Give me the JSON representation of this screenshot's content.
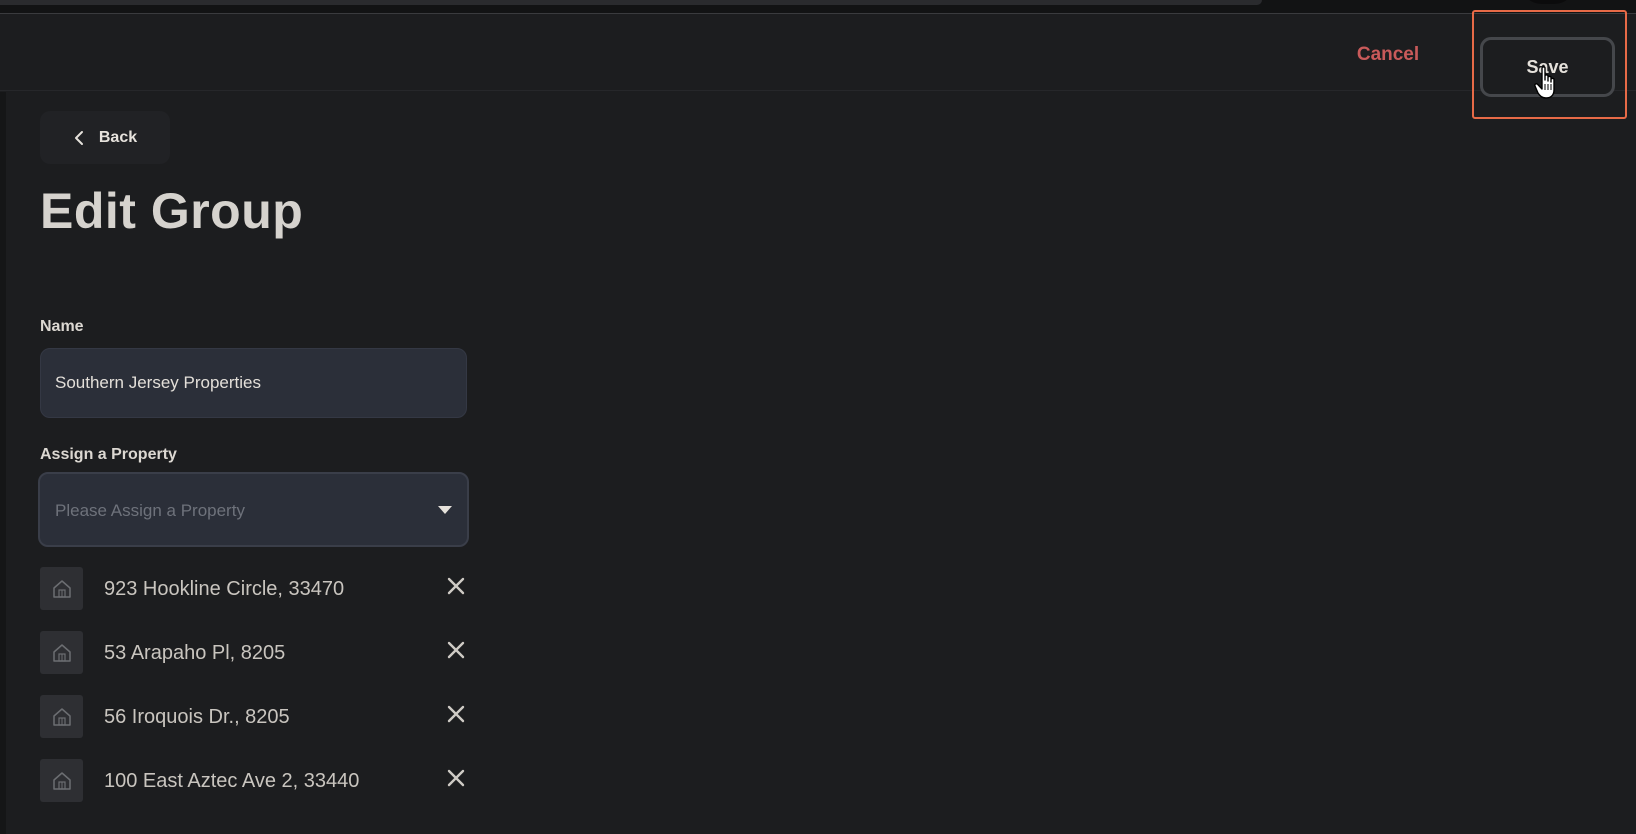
{
  "header": {
    "cancel_label": "Cancel",
    "save_label": "Save"
  },
  "page": {
    "back_label": "Back",
    "title": "Edit Group"
  },
  "form": {
    "name_label": "Name",
    "name_value": "Southern Jersey Properties",
    "assign_label": "Assign a Property",
    "assign_placeholder": "Please Assign a Property"
  },
  "properties": [
    {
      "label": "923 Hookline Circle, 33470"
    },
    {
      "label": "53 Arapaho Pl, 8205"
    },
    {
      "label": "56 Iroquois Dr., 8205"
    },
    {
      "label": "100 East Aztec Ave 2, 33440"
    }
  ],
  "colors": {
    "accent_cancel": "#c95a5a",
    "highlight": "#e76a47",
    "background": "#1c1d1f",
    "input_bg": "#2b2f39"
  },
  "icons": {
    "back": "chevron-left-icon",
    "dropdown": "caret-down-icon",
    "property": "house-icon",
    "remove": "close-icon",
    "cursor": "hand-pointer-icon"
  }
}
